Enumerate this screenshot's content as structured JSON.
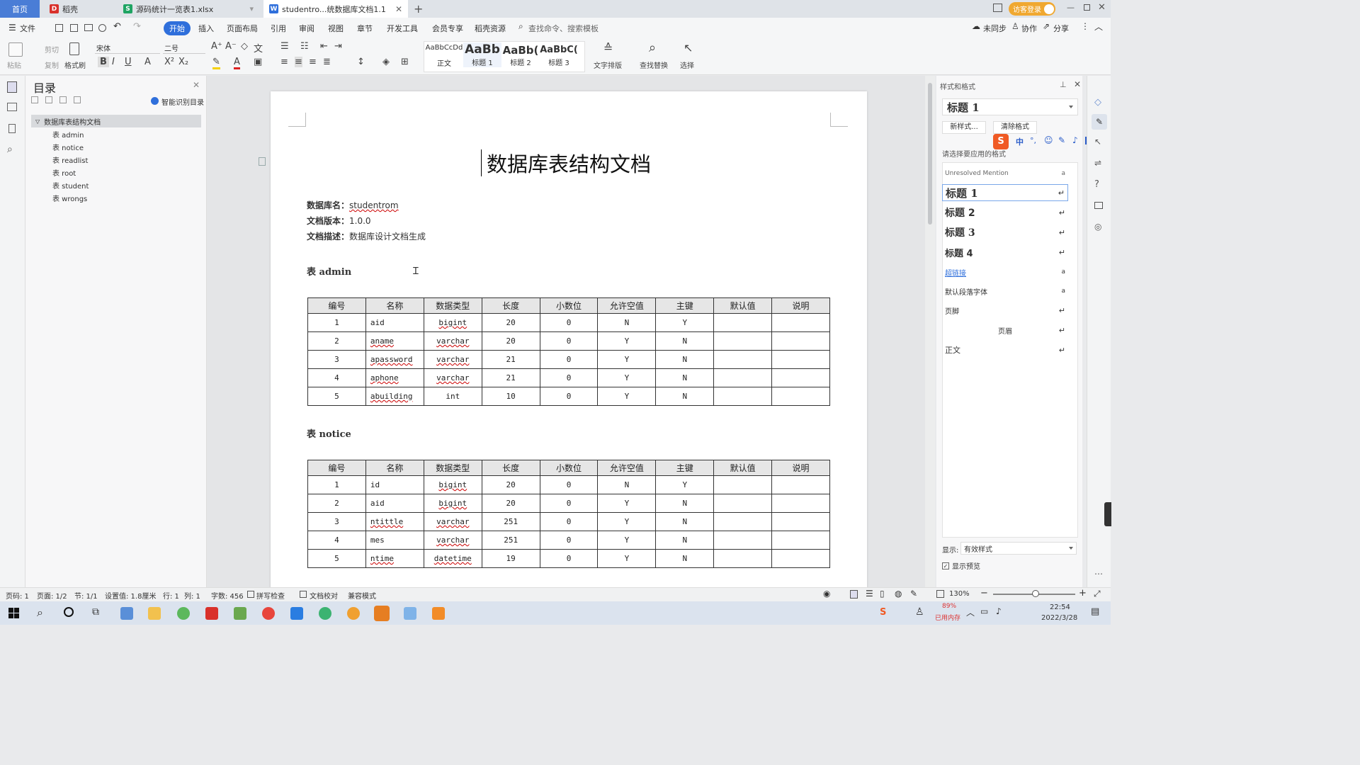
{
  "tabs": {
    "home": "首页",
    "daoke": "稻壳",
    "xlsx": "源码统计一览表1.xlsx",
    "doc": "studentro...统数据库文档1.1",
    "login": "访客登录"
  },
  "menu": {
    "file": "文件",
    "start": "开始",
    "insert": "插入",
    "layout": "页面布局",
    "ref": "引用",
    "review": "审阅",
    "view": "视图",
    "chapter": "章节",
    "dev": "开发工具",
    "member": "会员专享",
    "res": "稻壳资源",
    "search": "查找命令、搜索模板",
    "unsynced": "未同步",
    "collab": "协作",
    "share": "分享"
  },
  "ribbon": {
    "paste": "粘贴",
    "cut": "剪切",
    "copy": "复制",
    "format_painter": "格式刷",
    "font": "宋体",
    "size": "二号",
    "style_normal_preview": "AaBbCcDd",
    "style_normal": "正文",
    "style_h1_preview": "AaBb",
    "style_h1": "标题 1",
    "style_h2_preview": "AaBb(",
    "style_h2": "标题 2",
    "style_h3_preview": "AaBbC(",
    "style_h3": "标题 3",
    "text_layout": "文字排版",
    "find_replace": "查找替换",
    "select": "选择"
  },
  "toc": {
    "title": "目录",
    "smart": "智能识别目录",
    "root": "数据库表结构文档",
    "items": [
      "表 admin",
      "表 notice",
      "表 readlist",
      "表 root",
      "表 student",
      "表 wrongs"
    ]
  },
  "doc": {
    "title": "数据库表结构文档",
    "meta": [
      {
        "label": "数据库名：",
        "value": "studentrom"
      },
      {
        "label": "文档版本：",
        "value": "1.0.0"
      },
      {
        "label": "文档描述：",
        "value": "数据库设计文档生成"
      }
    ],
    "headers": [
      "编号",
      "名称",
      "数据类型",
      "长度",
      "小数位",
      "允许空值",
      "主键",
      "默认值",
      "说明"
    ],
    "tables": [
      {
        "title": "表 admin",
        "rows": [
          [
            "1",
            "aid",
            "bigint",
            "20",
            "0",
            "N",
            "Y",
            "",
            ""
          ],
          [
            "2",
            "aname",
            "varchar",
            "20",
            "0",
            "Y",
            "N",
            "",
            ""
          ],
          [
            "3",
            "apassword",
            "varchar",
            "21",
            "0",
            "Y",
            "N",
            "",
            ""
          ],
          [
            "4",
            "aphone",
            "varchar",
            "21",
            "0",
            "Y",
            "N",
            "",
            ""
          ],
          [
            "5",
            "abuilding",
            "int",
            "10",
            "0",
            "Y",
            "N",
            "",
            ""
          ]
        ]
      },
      {
        "title": "表 notice",
        "rows": [
          [
            "1",
            "id",
            "bigint",
            "20",
            "0",
            "N",
            "Y",
            "",
            ""
          ],
          [
            "2",
            "aid",
            "bigint",
            "20",
            "0",
            "Y",
            "N",
            "",
            ""
          ],
          [
            "3",
            "ntittle",
            "varchar",
            "251",
            "0",
            "Y",
            "N",
            "",
            ""
          ],
          [
            "4",
            "mes",
            "varchar",
            "251",
            "0",
            "Y",
            "N",
            "",
            ""
          ],
          [
            "5",
            "ntime",
            "datetime",
            "19",
            "0",
            "Y",
            "N",
            "",
            ""
          ]
        ]
      }
    ]
  },
  "styles_panel": {
    "title": "样式和格式",
    "current": "标题  1",
    "new_style": "新样式...",
    "clear": "清除格式",
    "prompt": "请选择要应用的格式",
    "items": [
      "Unresolved Mention",
      "标题  1",
      "标题  2",
      "标题  3",
      "标题  4",
      "超链接",
      "默认段落字体",
      "页脚",
      "页眉",
      "正文"
    ],
    "show_label": "显示:",
    "show_value": "有效样式",
    "preview": "显示预览"
  },
  "status": {
    "page_no": "页码: 1",
    "page": "页面: 1/2",
    "section": "节: 1/1",
    "setting": "设置值: 1.8厘米",
    "row": "行: 1",
    "col": "列: 1",
    "words": "字数: 456",
    "spell": "拼写检查",
    "proof": "文档校对",
    "compat": "兼容模式",
    "zoom": "130%"
  },
  "taskbar": {
    "mem": "89%",
    "mem_label": "已用内存",
    "time": "22:54",
    "date": "2022/3/28"
  },
  "colors": {
    "accent": "#2f6fdb",
    "tab_active": "#ffffff",
    "home_tab": "#4a7dd6",
    "login_btn": "#f0a830"
  }
}
